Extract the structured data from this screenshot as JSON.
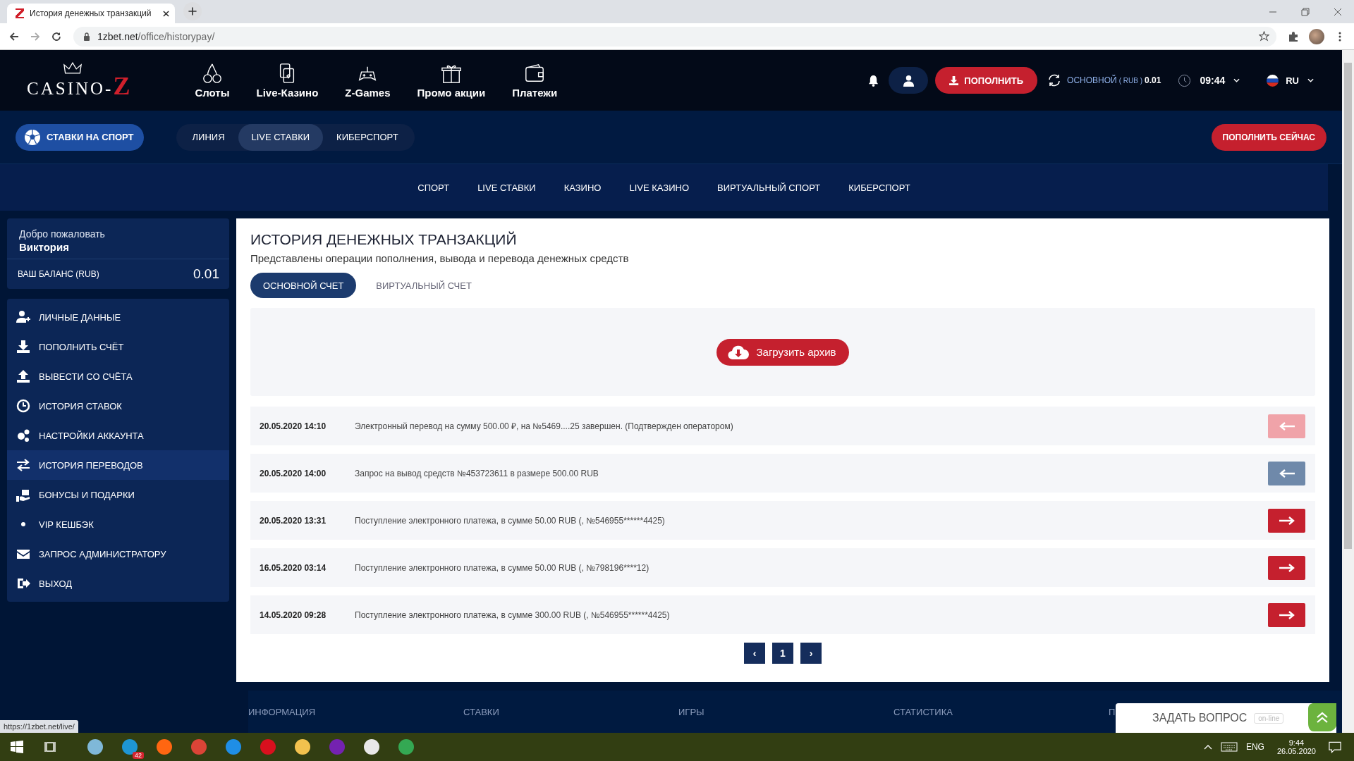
{
  "browser": {
    "tab_title": "История денежных транзакций",
    "url_host": "1zbet.net",
    "url_path": "/office/historypay/",
    "status_link": "https://1zbet.net/live/"
  },
  "header": {
    "logo": {
      "word": "CASINO-",
      "letter": "Z"
    },
    "nav": [
      "Слоты",
      "Live-Казино",
      "Z-Games",
      "Промо акции",
      "Платежи"
    ],
    "deposit_button": "ПОПОЛНИТЬ",
    "balance": {
      "label": "ОСНОВНОЙ",
      "currency": "( RUB )",
      "amount": "0.01"
    },
    "time": "09:44",
    "language": "RU"
  },
  "sport_bar": {
    "sport_button": "СТАВКИ НА СПОРТ",
    "tabs": [
      {
        "label": "ЛИНИЯ",
        "selected": false
      },
      {
        "label": "LIVE СТАВКИ",
        "selected": true
      },
      {
        "label": "КИБЕРСПОРТ",
        "selected": false
      }
    ],
    "deposit_now": "ПОПОЛНИТЬ СЕЙЧАС"
  },
  "subnav": [
    "СПОРТ",
    "LIVE СТАВКИ",
    "КАЗИНО",
    "LIVE КАЗИНО",
    "ВИРТУАЛЬНЫЙ СПОРТ",
    "КИБЕРСПОРТ"
  ],
  "sidebar": {
    "greeting": "Добро пожаловать",
    "user_name": "Виктория",
    "balance_label": "ВАШ БАЛАНС (RUB)",
    "balance_value": "0.01",
    "menu": [
      {
        "label": "ЛИЧНЫЕ ДАННЫЕ",
        "selected": false
      },
      {
        "label": "ПОПОЛНИТЬ СЧЁТ",
        "selected": false
      },
      {
        "label": "ВЫВЕСТИ СО СЧЁТА",
        "selected": false
      },
      {
        "label": "ИСТОРИЯ СТАВОК",
        "selected": false
      },
      {
        "label": "НАСТРОЙКИ АККАУНТА",
        "selected": false
      },
      {
        "label": "ИСТОРИЯ ПЕРЕВОДОВ",
        "selected": true
      },
      {
        "label": "БОНУСЫ И ПОДАРКИ",
        "selected": false
      },
      {
        "label": "VIP КЕШБЭК",
        "selected": false
      },
      {
        "label": "ЗАПРОС АДМИНИСТРАТОРУ",
        "selected": false
      },
      {
        "label": "ВЫХОД",
        "selected": false
      }
    ]
  },
  "content": {
    "title": "ИСТОРИЯ ДЕНЕЖНЫХ ТРАНЗАКЦИЙ",
    "subtitle": "Представлены операции пополнения, вывода и перевода денежных средств",
    "account_tabs": [
      {
        "label": "ОСНОВНОЙ СЧЕТ",
        "selected": true
      },
      {
        "label": "ВИРТУАЛЬНЫЙ СЧЕТ",
        "selected": false
      }
    ],
    "archive_button": "Загрузить архив",
    "transactions": [
      {
        "date": "20.05.2020 14:10",
        "text": "Электронный перевод на сумму 500.00 ₽, на №5469....25 завершен. (Подтвержден оператором)",
        "kind": "outgoing",
        "color": "#f0a3a9"
      },
      {
        "date": "20.05.2020 14:00",
        "text": "Запрос на вывод средств №453723611 в размере 500.00 RUB",
        "kind": "outgoing",
        "color": "#6f89aa"
      },
      {
        "date": "20.05.2020 13:31",
        "text": "Поступление электронного платежа, в сумме 50.00 RUB (, №546955******4425)",
        "kind": "incoming",
        "color": "#c5202e"
      },
      {
        "date": "16.05.2020 03:14",
        "text": "Поступление электронного платежа, в сумме 50.00 RUB (, №798196****12)",
        "kind": "incoming",
        "color": "#c5202e"
      },
      {
        "date": "14.05.2020 09:28",
        "text": "Поступление электронного платежа, в сумме 300.00 RUB (, №546955******4425)",
        "kind": "incoming",
        "color": "#c5202e"
      }
    ],
    "pagination": {
      "prev": "‹",
      "page": "1",
      "next": "›"
    }
  },
  "footer": [
    "ИНФОРМАЦИЯ",
    "СТАВКИ",
    "ИГРЫ",
    "СТАТИСТИКА",
    "П"
  ],
  "chat": {
    "label": "ЗАДАТЬ ВОПРОС",
    "status": "on-line"
  },
  "taskbar": {
    "badge": "42",
    "language": "ENG",
    "time": "9:44",
    "date": "26.05.2020"
  }
}
